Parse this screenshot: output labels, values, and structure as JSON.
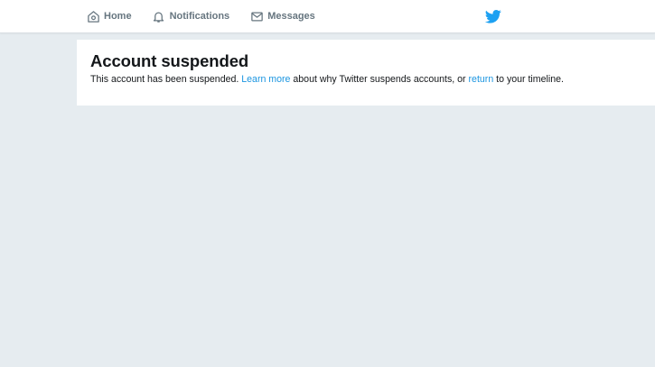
{
  "nav": {
    "items": [
      {
        "label": "Home",
        "icon": "home-icon"
      },
      {
        "label": "Notifications",
        "icon": "bell-icon"
      },
      {
        "label": "Messages",
        "icon": "envelope-icon"
      }
    ],
    "logo_icon": "twitter-bird-icon"
  },
  "colors": {
    "background": "#e6ecf0",
    "brand_blue": "#1da1f2",
    "link": "#1b95e0",
    "nav_text": "#66757f"
  },
  "notice": {
    "title": "Account suspended",
    "text_before": "This account has been suspended. ",
    "learn_more_link": "Learn more",
    "text_middle": " about why Twitter suspends accounts, or ",
    "return_link": "return",
    "text_after": " to your timeline."
  }
}
